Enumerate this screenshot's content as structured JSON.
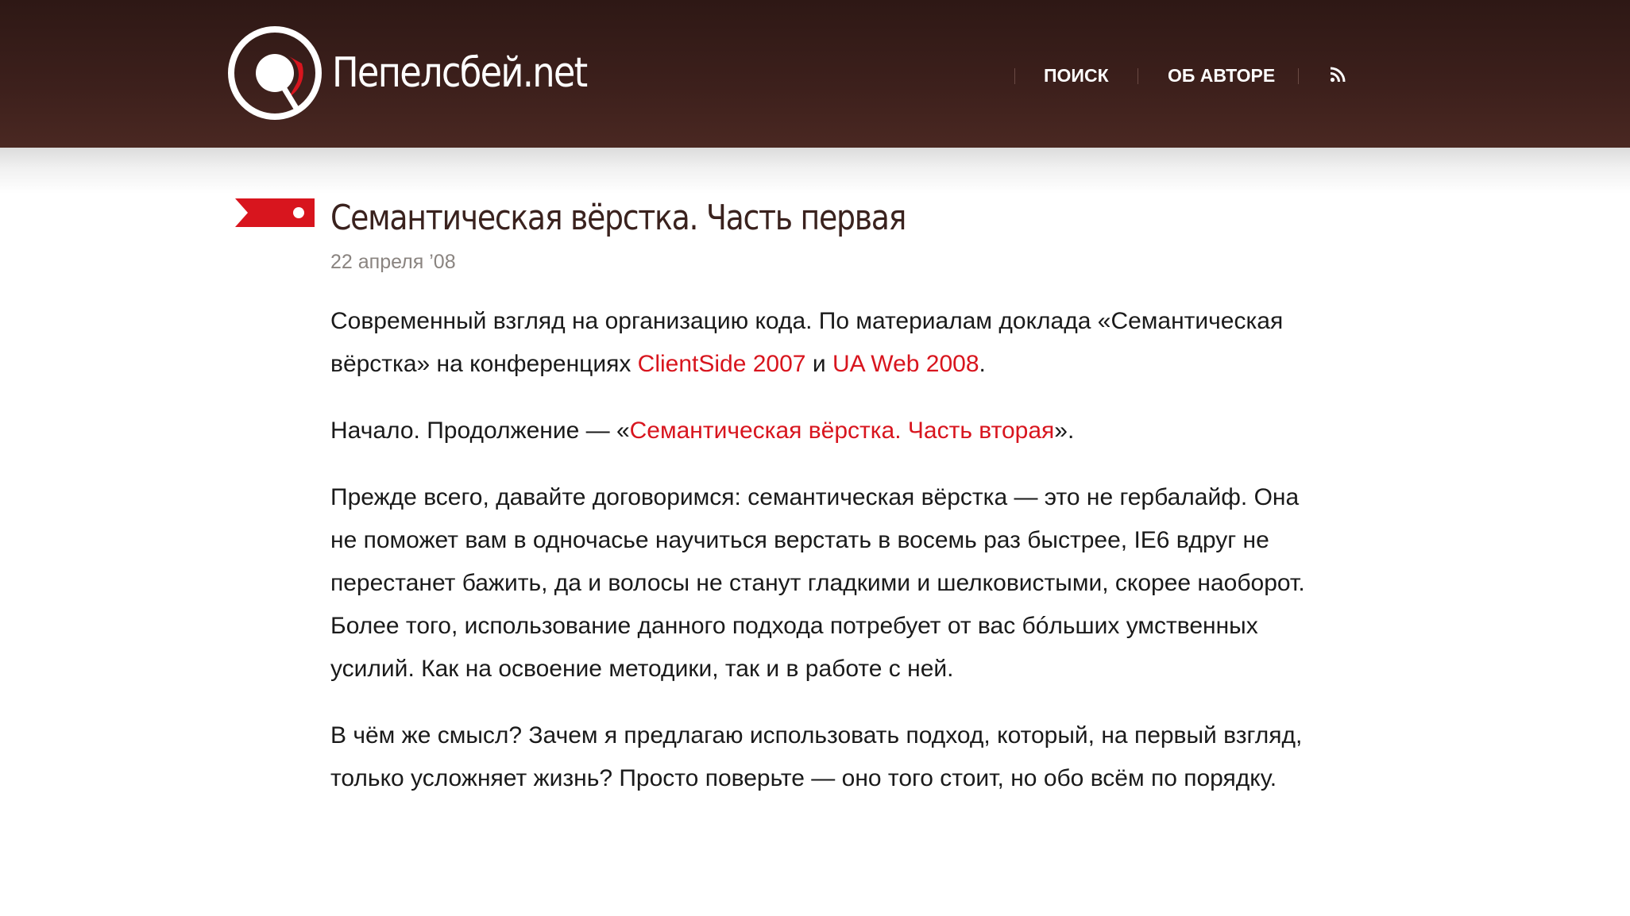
{
  "site": {
    "name": "Пепелсбей.net"
  },
  "nav": {
    "search_label": "ПОИСК",
    "about_label": "ОБ АВТОРЕ"
  },
  "icons": {
    "logo": "logo-icon",
    "rss": "rss-icon",
    "bookmark": "bookmark-ribbon-icon"
  },
  "colors": {
    "header_background": "#3d201c",
    "accent": "#d8151e",
    "title": "#3a221e"
  },
  "article": {
    "title": "Семантическая вёрстка. Часть первая",
    "date": "22 апреля ’08",
    "intro": {
      "text_1": "Современный взгляд на организацию кода. По материалам доклада «Семантическая вёрстка» на конференциях ",
      "link_1": "ClientSide 2007",
      "text_2": " и ",
      "link_2": "UA Web 2008",
      "text_3": "."
    },
    "continuation": {
      "text_1": "Начало. Продолжение — «",
      "link": "Семантическая вёрстка. Часть вторая",
      "text_2": "»."
    },
    "paragraph_3": "Прежде всего, давайте договоримся: семантическая вёрстка — это не гербалайф. Она не поможет вам в одночасье научиться верстать в восемь раз быстрее, IE6 вдруг не перестанет бажить, да и волосы не станут гладкими и шелковистыми, скорее наоборот. Более того, использование данного подхода потребует от вас бóльших умственных усилий. Как на освоение методики, так и в работе с ней.",
    "paragraph_4": "В чём же смысл? Зачем я предлагаю использовать подход, который, на первый взгляд, только усложняет жизнь? Просто поверьте — оно того стоит, но обо всём по порядку."
  }
}
